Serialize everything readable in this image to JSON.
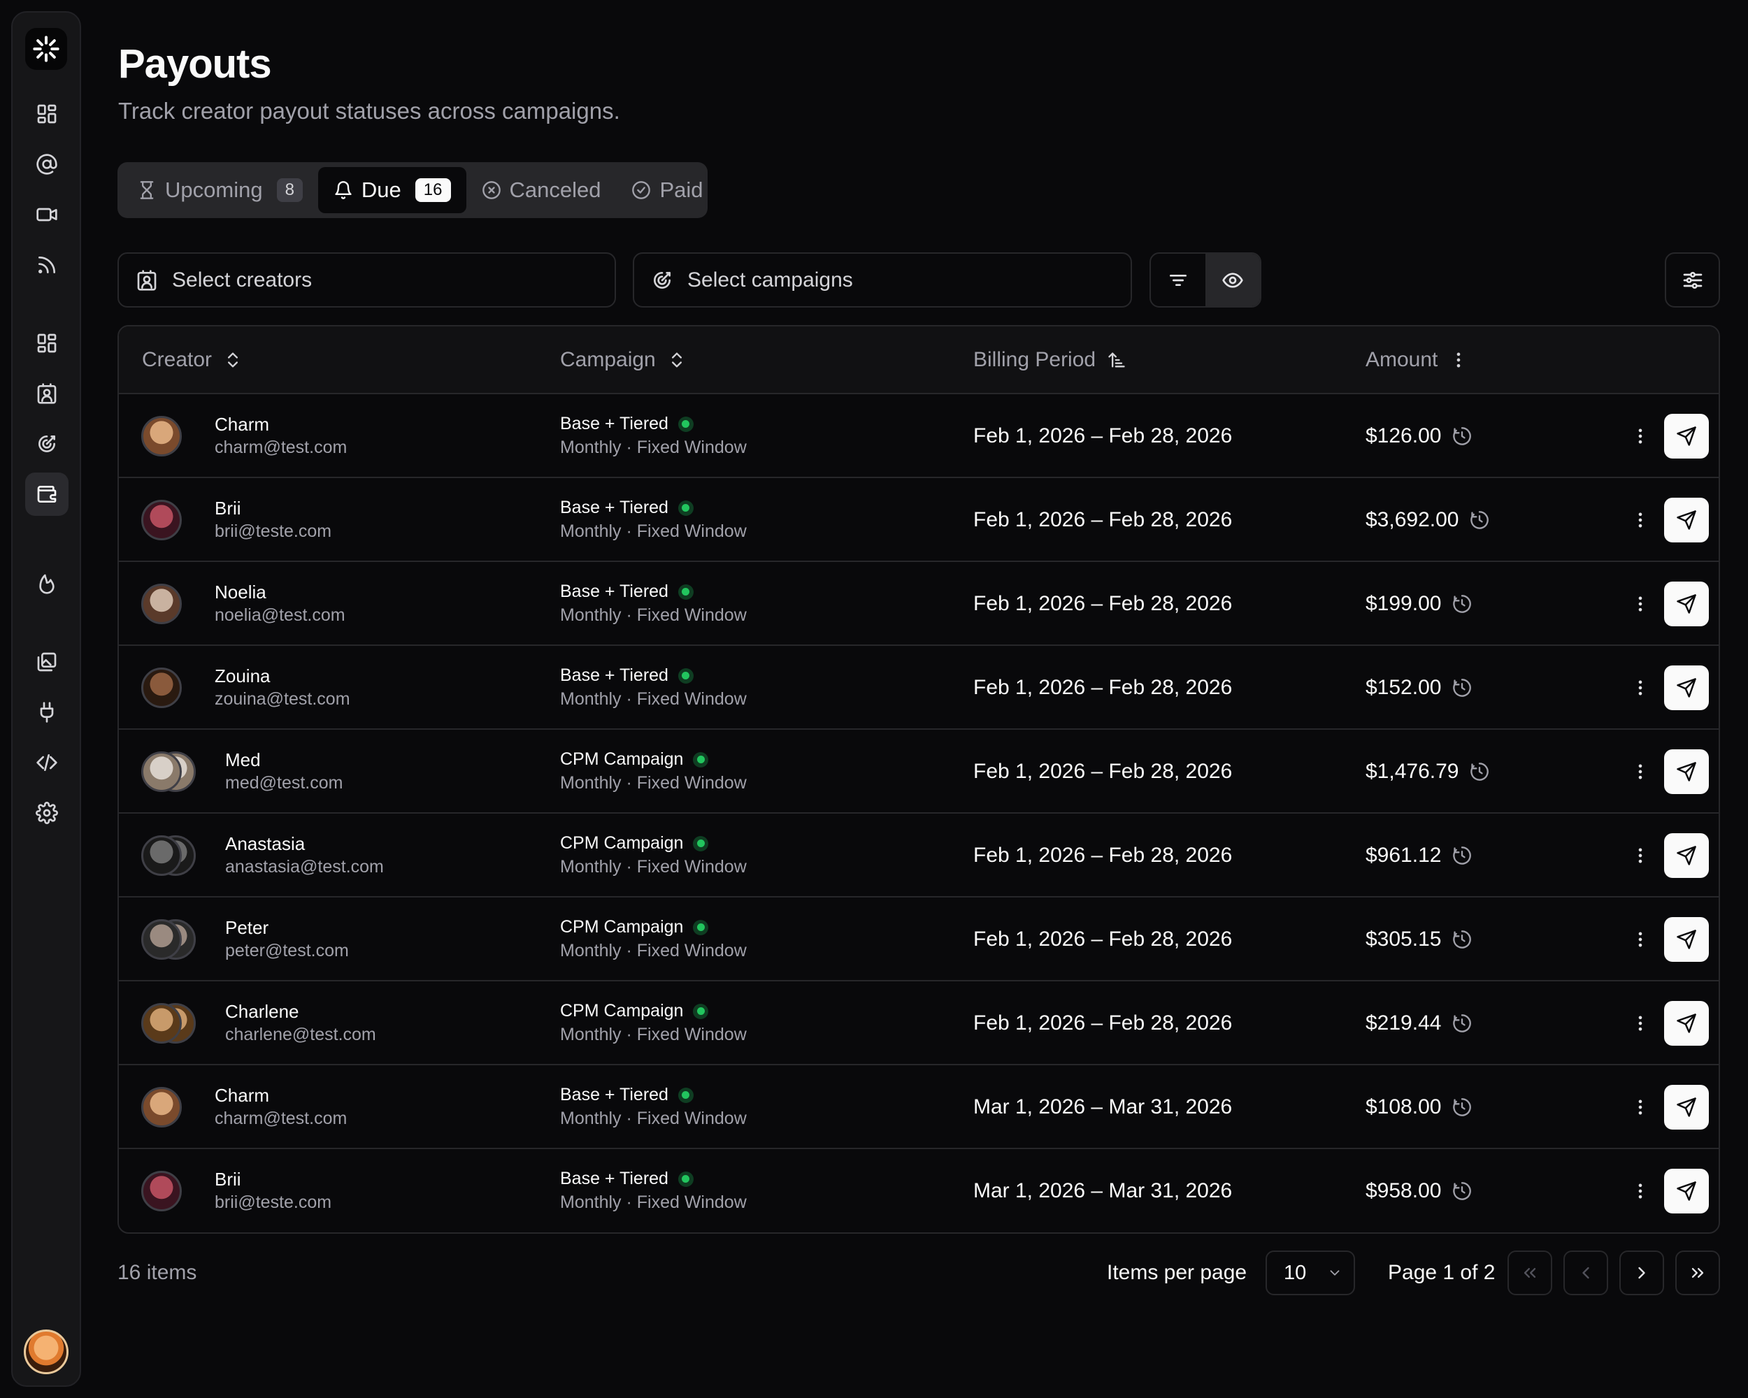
{
  "header": {
    "title": "Payouts",
    "subtitle": "Track creator payout statuses across campaigns."
  },
  "tabs": [
    {
      "label": "Upcoming",
      "count": "8",
      "icon": "hourglass-icon",
      "active": false
    },
    {
      "label": "Due",
      "count": "16",
      "icon": "bell-icon",
      "active": true
    },
    {
      "label": "Canceled",
      "icon": "x-circle-icon",
      "active": false
    },
    {
      "label": "Paid",
      "icon": "check-circle-icon",
      "active": false
    }
  ],
  "filters": {
    "creators_placeholder": "Select creators",
    "campaigns_placeholder": "Select campaigns"
  },
  "table": {
    "columns": [
      "Creator",
      "Campaign",
      "Billing Period",
      "Amount"
    ],
    "rows": [
      {
        "name": "Charm",
        "email": "charm@test.com",
        "campaign": "Base + Tiered",
        "campaign_sub": "Monthly · Fixed Window",
        "period": "Feb 1, 2026 – Feb 28, 2026",
        "amount": "$126.00"
      },
      {
        "name": "Brii",
        "email": "brii@teste.com",
        "campaign": "Base + Tiered",
        "campaign_sub": "Monthly · Fixed Window",
        "period": "Feb 1, 2026 – Feb 28, 2026",
        "amount": "$3,692.00"
      },
      {
        "name": "Noelia",
        "email": "noelia@test.com",
        "campaign": "Base + Tiered",
        "campaign_sub": "Monthly · Fixed Window",
        "period": "Feb 1, 2026 – Feb 28, 2026",
        "amount": "$199.00"
      },
      {
        "name": "Zouina",
        "email": "zouina@test.com",
        "campaign": "Base + Tiered",
        "campaign_sub": "Monthly · Fixed Window",
        "period": "Feb 1, 2026 – Feb 28, 2026",
        "amount": "$152.00"
      },
      {
        "name": "Med",
        "email": "med@test.com",
        "campaign": "CPM Campaign",
        "campaign_sub": "Monthly · Fixed Window",
        "period": "Feb 1, 2026 – Feb 28, 2026",
        "amount": "$1,476.79"
      },
      {
        "name": "Anastasia",
        "email": "anastasia@test.com",
        "campaign": "CPM Campaign",
        "campaign_sub": "Monthly · Fixed Window",
        "period": "Feb 1, 2026 – Feb 28, 2026",
        "amount": "$961.12"
      },
      {
        "name": "Peter",
        "email": "peter@test.com",
        "campaign": "CPM Campaign",
        "campaign_sub": "Monthly · Fixed Window",
        "period": "Feb 1, 2026 – Feb 28, 2026",
        "amount": "$305.15"
      },
      {
        "name": "Charlene",
        "email": "charlene@test.com",
        "campaign": "CPM Campaign",
        "campaign_sub": "Monthly · Fixed Window",
        "period": "Feb 1, 2026 – Feb 28, 2026",
        "amount": "$219.44"
      },
      {
        "name": "Charm",
        "email": "charm@test.com",
        "campaign": "Base + Tiered",
        "campaign_sub": "Monthly · Fixed Window",
        "period": "Mar 1, 2026 – Mar 31, 2026",
        "amount": "$108.00"
      },
      {
        "name": "Brii",
        "email": "brii@teste.com",
        "campaign": "Base + Tiered",
        "campaign_sub": "Monthly · Fixed Window",
        "period": "Mar 1, 2026 – Mar 31, 2026",
        "amount": "$958.00"
      }
    ]
  },
  "footer": {
    "items_count": "16 items",
    "items_per_page_label": "Items per page",
    "items_per_page_value": "10",
    "page_label": "Page 1 of 2"
  },
  "colors": {
    "background": "#09090b",
    "status_active": "#22c55e",
    "border": "#27272a"
  }
}
